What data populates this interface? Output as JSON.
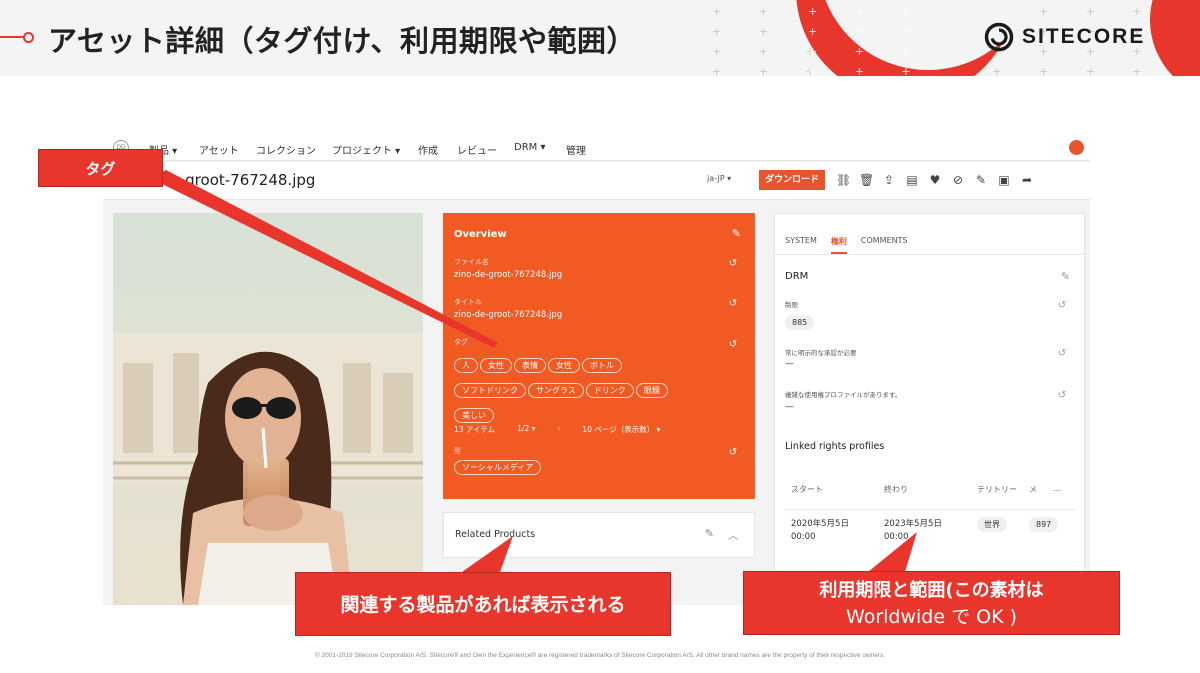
{
  "slide": {
    "title": "アセット詳細（タグ付け、利用期限や範囲）",
    "brand": "SITECORE",
    "footer": "© 2001-2019 Sitecore Corporation A/S. Sitecore® and Own the Experience® are registered trademarks of Sitecore Corporation A/S. All other brand names are the property of their respective owners.",
    "accent_color": "#e8362c"
  },
  "app": {
    "nav": {
      "logo_text": "DD",
      "items": [
        "製品 ▾",
        "アセット",
        "コレクション",
        "プロジェクト ▾",
        "作成",
        "レビュー",
        "DRM ▾",
        "管理"
      ]
    },
    "asset_title": "de-groot-767248.jpg",
    "language": "ja-JP ▾",
    "download_label": "ダウンロード",
    "toolbar_icons": [
      "link-icon",
      "trash-icon",
      "upload-icon",
      "comment-icon",
      "heart-icon",
      "unlike-icon",
      "edit-icon",
      "archive-icon",
      "share-icon"
    ],
    "overview": {
      "heading": "Overview",
      "file_label": "ファイル名",
      "file_value": "zino-de-groot-767248.jpg",
      "title_label": "タイトル",
      "title_value": "zino-de-groot-767248.jpg",
      "tags_label": "タグ",
      "tags": [
        "人",
        "女性",
        "表情",
        "女性",
        "ボトル",
        "ソフトドリンク",
        "サングラス",
        "ドリンク",
        "眼鏡",
        "美しい"
      ],
      "items_count": "13 アイテム",
      "page": "1/2 ▾",
      "next": "›",
      "per_page": "10 ページ（表示数） ▾",
      "group_label": "型",
      "group_value": "ソーシャルメディア"
    },
    "related": {
      "title": "Related Products"
    },
    "rights": {
      "tabs": [
        "SYSTEM",
        "権利",
        "COMMENTS"
      ],
      "drm_title": "DRM",
      "restriction_label": "制限",
      "restriction_value": "885",
      "approval_label": "常に明示的な承認が必要",
      "approval_value": "—",
      "profiles_label": "複雑な使用権プロファイルがあります。",
      "profiles_value": "—",
      "linked_title": "Linked rights profiles",
      "columns": [
        "スタート",
        "終わり",
        "テリトリー",
        "メ",
        "…"
      ],
      "row": {
        "start": "2020年5月5日",
        "start_time": "00:00",
        "end": "2023年5月5日",
        "end_time": "00:00",
        "territory": "世界",
        "media": "897"
      }
    }
  },
  "callouts": {
    "tag": "タグ",
    "related": "関連する製品があれば表示される",
    "rights_line1": "利用期限と範囲(この素材は",
    "rights_line2": "Worldwide で OK )"
  }
}
